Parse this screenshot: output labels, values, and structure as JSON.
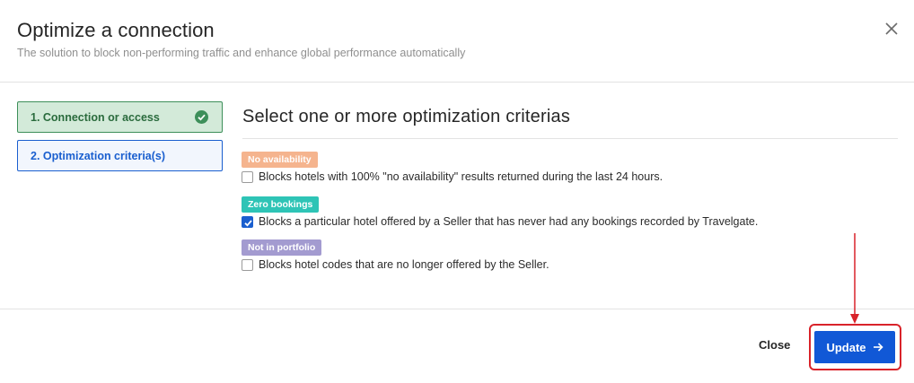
{
  "header": {
    "title": "Optimize a connection",
    "subtitle": "The solution to block non-performing traffic and enhance global performance automatically",
    "close_icon": "close-icon"
  },
  "steps": [
    {
      "label": "1. Connection or access",
      "status": "completed",
      "icon": "check-circle-icon"
    },
    {
      "label": "2. Optimization criteria(s)",
      "status": "active"
    }
  ],
  "content": {
    "title": "Select one or more optimization criterias",
    "criteria": [
      {
        "badge": "No availability",
        "badge_color": "#f5b48e",
        "description": "Blocks hotels with 100% \"no availability\" results returned during the last 24 hours.",
        "checked": false
      },
      {
        "badge": "Zero bookings",
        "badge_color": "#2ec4b6",
        "description": "Blocks a particular hotel offered by a Seller that has never had any bookings recorded by Travelgate.",
        "checked": true
      },
      {
        "badge": "Not in portfolio",
        "badge_color": "#a39bd0",
        "description": "Blocks hotel codes that are no longer offered by the Seller.",
        "checked": false
      }
    ]
  },
  "footer": {
    "close_label": "Close",
    "update_label": "Update",
    "update_icon": "arrow-right-icon"
  },
  "colors": {
    "primary": "#1158d6",
    "success": "#3d8f5a",
    "annotation": "#d9232a"
  }
}
